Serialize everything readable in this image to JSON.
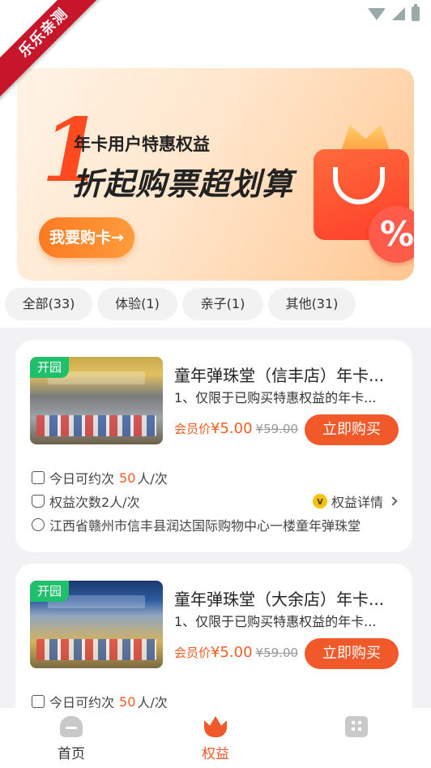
{
  "ribbon": "乐乐亲测",
  "banner": {
    "big_number": "1",
    "subtitle": "年卡用户特惠权益",
    "headline": "折起购票超划算",
    "cta": "我要购卡→",
    "percent_symbol": "%"
  },
  "filters": [
    {
      "label": "全部(33)"
    },
    {
      "label": "体验(1)"
    },
    {
      "label": "亲子(1)"
    },
    {
      "label": "其他(31)"
    }
  ],
  "cards": [
    {
      "badge": "开园",
      "thumb_sign": "童年 弹珠堂",
      "title": "童年弹珠堂（信丰店）年卡...",
      "desc": "1、仅限于已购买特惠权益的年卡...",
      "price_label": "会员价",
      "price": "¥5.00",
      "original_price": "¥59.00",
      "buy": "立即购买",
      "today_prefix": "今日可约次",
      "today_count": "50",
      "today_suffix": "人/次",
      "quota": "权益次数2人/次",
      "detail": "权益详情",
      "address": "江西省赣州市信丰县润达国际购物中心一楼童年弹珠堂"
    },
    {
      "badge": "开园",
      "thumb_sign": "童年 弹珠堂",
      "title": "童年弹珠堂（大余店）年卡...",
      "desc": "1、仅限于已购买特惠权益的年卡...",
      "price_label": "会员价",
      "price": "¥5.00",
      "original_price": "¥59.00",
      "buy": "立即购买",
      "today_prefix": "今日可约次",
      "today_count": "50",
      "today_suffix": "人/次"
    }
  ],
  "nav": [
    {
      "label": "首页",
      "icon": "home-icon"
    },
    {
      "label": "权益",
      "icon": "crown-icon",
      "active": true
    },
    {
      "label": "",
      "icon": "mine-icon"
    }
  ],
  "colors": {
    "accent": "#f2592a",
    "open_badge": "#20bf6b",
    "ribbon": "#c7162a"
  }
}
